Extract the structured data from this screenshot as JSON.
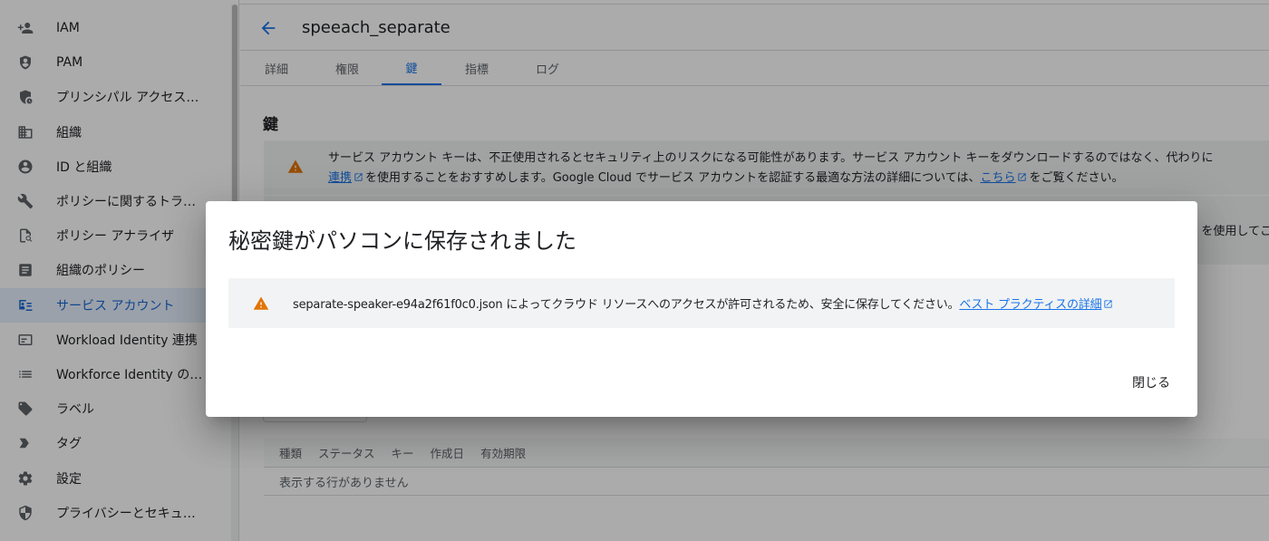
{
  "sidebar": {
    "items": [
      {
        "label": "IAM",
        "icon": "person-add-icon",
        "active": false
      },
      {
        "label": "PAM",
        "icon": "shield-icon",
        "active": false
      },
      {
        "label": "プリンシパル アクセス…",
        "icon": "shield-clock-icon",
        "active": false
      },
      {
        "label": "組織",
        "icon": "domain-icon",
        "active": false
      },
      {
        "label": "ID と組織",
        "icon": "account-circle-icon",
        "active": false
      },
      {
        "label": "ポリシーに関するトラ…",
        "icon": "wrench-icon",
        "active": false
      },
      {
        "label": "ポリシー アナライザ",
        "icon": "policy-search-icon",
        "active": false
      },
      {
        "label": "組織のポリシー",
        "icon": "list-box-icon",
        "active": false
      },
      {
        "label": "サービス アカウント",
        "icon": "service-account-icon",
        "active": true
      },
      {
        "label": "Workload Identity 連携",
        "icon": "card-icon",
        "active": false
      },
      {
        "label": "Workforce Identity の連…",
        "icon": "list-icon",
        "active": false
      },
      {
        "label": "ラベル",
        "icon": "tag-icon",
        "active": false
      },
      {
        "label": "タグ",
        "icon": "chevron-tag-icon",
        "active": false
      },
      {
        "label": "設定",
        "icon": "gear-icon",
        "active": false
      },
      {
        "label": "プライバシーとセキュ…",
        "icon": "security-shield-icon",
        "active": false
      }
    ]
  },
  "header": {
    "title": "speeach_separate"
  },
  "tabs": [
    {
      "label": "詳細",
      "active": false
    },
    {
      "label": "権限",
      "active": false
    },
    {
      "label": "鍵",
      "active": true
    },
    {
      "label": "指標",
      "active": false
    },
    {
      "label": "ログ",
      "active": false
    }
  ],
  "keys_section": {
    "title": "鍵",
    "warning": {
      "line1": "サービス アカウント キーは、不正使用されるとセキュリティ上のリスクになる可能性があります。サービス アカウント キーをダウンロードするのではなく、代わりに",
      "link1": "連携",
      "line2_mid": "を使用することをおすすめします。Google Cloud でサービス アカウントを認証する最適な方法の詳細については、",
      "link2": "こちら",
      "line2_end": "をご覧ください。"
    },
    "second_banner_text": "を使用してこ",
    "table": {
      "headers": [
        "種類",
        "ステータス",
        "キー",
        "作成日",
        "有効期限"
      ],
      "empty_text": "表示する行がありません"
    }
  },
  "dialog": {
    "title": "秘密鍵がパソコンに保存されました",
    "message": "separate-speaker-e94a2f61f0c0.json によってクラウド リソースへのアクセスが許可されるため、安全に保存してください。",
    "link": "ベスト プラクティスの詳細",
    "close_label": "閉じる"
  },
  "colors": {
    "accent": "#1a73e8",
    "warning": "#e37400",
    "active_nav_bg": "#e8f0fe"
  }
}
